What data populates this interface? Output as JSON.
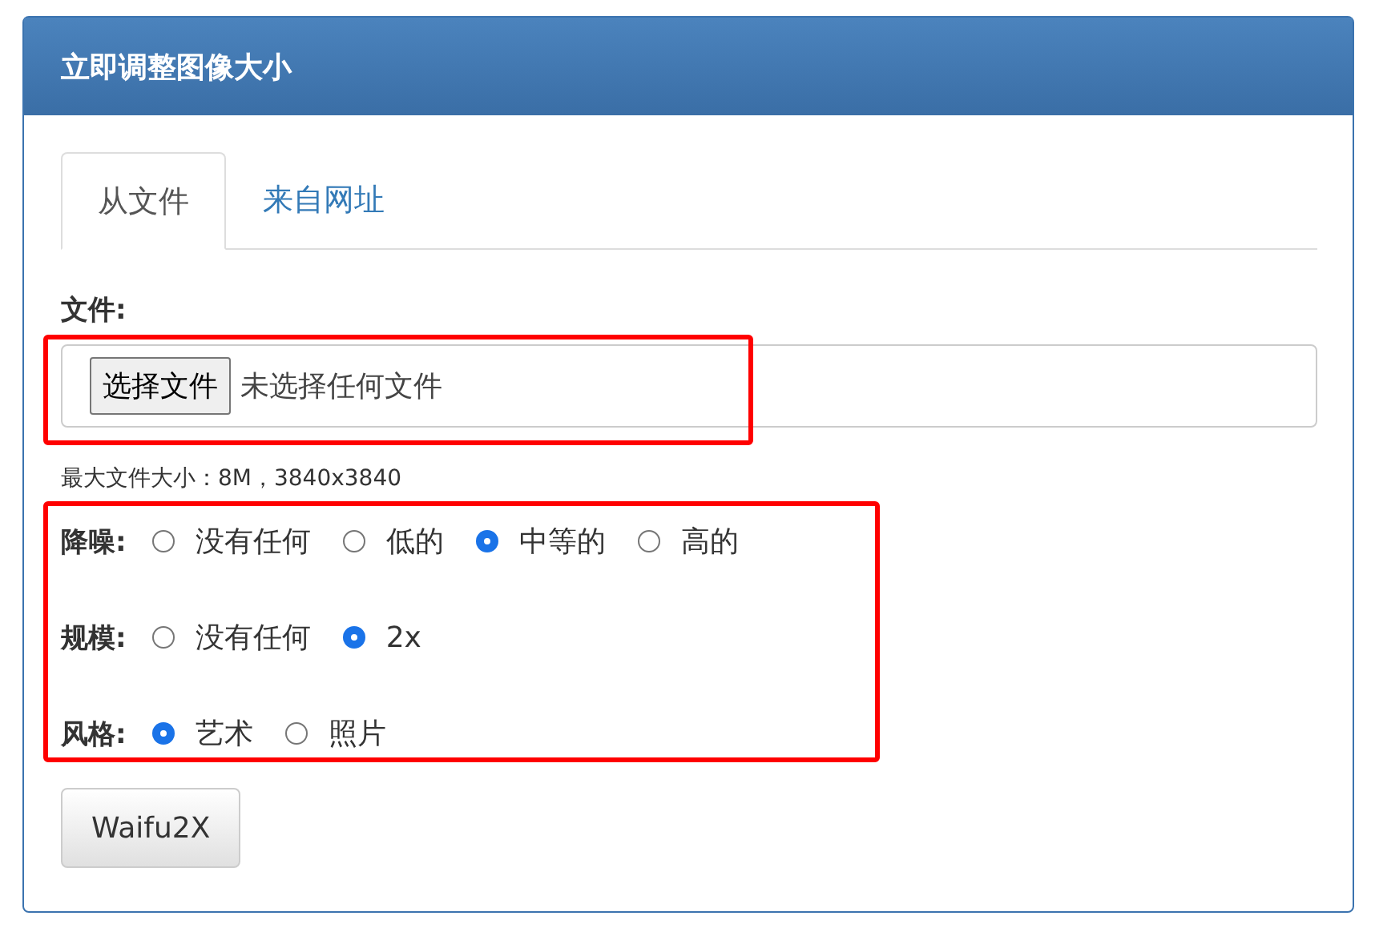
{
  "panel": {
    "title": "立即调整图像大小"
  },
  "tabs": [
    {
      "label": "从文件",
      "selected": true
    },
    {
      "label": "来自网址",
      "selected": false
    }
  ],
  "file": {
    "label": "文件:",
    "button": "选择文件",
    "status": "未选择任何文件",
    "hint": "最大文件大小：8M，3840x3840"
  },
  "options": [
    {
      "label": "降噪:",
      "choices": [
        {
          "label": "没有任何",
          "selected": false
        },
        {
          "label": "低的",
          "selected": false
        },
        {
          "label": "中等的",
          "selected": true
        },
        {
          "label": "高的",
          "selected": false
        }
      ]
    },
    {
      "label": "规模:",
      "choices": [
        {
          "label": "没有任何",
          "selected": false
        },
        {
          "label": "2x",
          "selected": true
        }
      ]
    },
    {
      "label": "风格:",
      "choices": [
        {
          "label": "艺术",
          "selected": true
        },
        {
          "label": "照片",
          "selected": false
        }
      ]
    }
  ],
  "submit": "Waifu2X"
}
